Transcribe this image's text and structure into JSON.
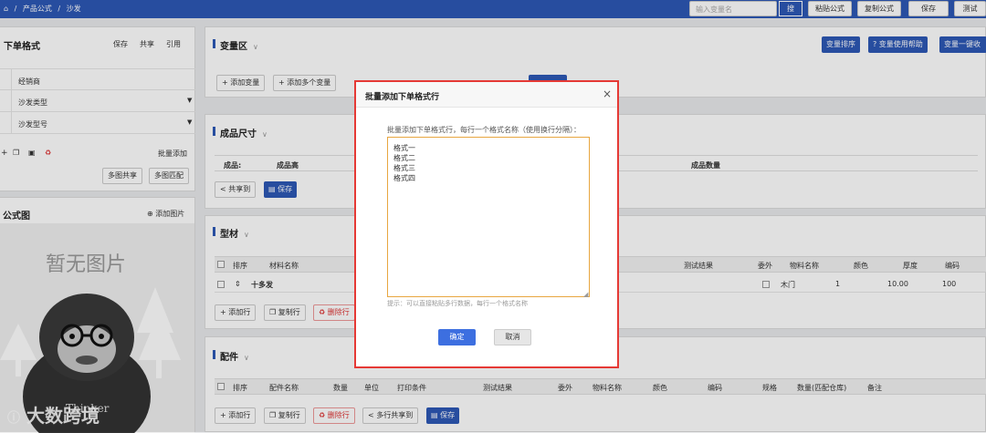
{
  "breadcrumb": {
    "sep": "/",
    "parent": "产品公式",
    "current": "沙发"
  },
  "toolbar": {
    "search_placeholder": "输入变量名",
    "search_label": "搜",
    "buttons": [
      "粘贴公式",
      "复制公式",
      "保存",
      "测试"
    ]
  },
  "left_panel": {
    "title": "下单格式",
    "actions": [
      "保存",
      "共享",
      "引用"
    ],
    "rows": [
      {
        "label": "经销商",
        "dropdown": false
      },
      {
        "label": "沙发类型",
        "dropdown": true
      },
      {
        "label": "沙发型号",
        "dropdown": true
      }
    ],
    "batch_add": "批量添加",
    "multi_share": "多图共享",
    "multi_match": "多图匹配",
    "formula_image_title": "公式图",
    "add_image": "添加图片",
    "no_image_text": "暂无图片",
    "thinker_text": "Thinker"
  },
  "variable_section": {
    "title": "变量区",
    "add_var": "添加变量",
    "add_multi_var": "添加多个变量",
    "right_buttons": [
      "变量排序",
      "? 变量使用帮助",
      "变量一键收"
    ]
  },
  "size_section": {
    "title": "成品尺寸",
    "labels": [
      "成品:",
      "成品高",
      "成品数量"
    ],
    "share_to": "共享到",
    "save": "保存"
  },
  "profile_section": {
    "title": "型材",
    "headers_left": [
      "排序",
      "材料名称"
    ],
    "headers_right": [
      "测试结果",
      "委外",
      "物料名称",
      "颜色",
      "厚度",
      "编码"
    ],
    "row": {
      "sort": "⇕",
      "name": "十多发",
      "material": "木门",
      "qty": "1",
      "thickness": "10.00",
      "code": "100"
    },
    "add_row": "添加行",
    "copy_row": "复制行",
    "delete_row": "删除行"
  },
  "parts_section": {
    "title": "配件",
    "headers": [
      "排序",
      "配件名称",
      "数量",
      "单位",
      "打印条件",
      "测试结果",
      "委外",
      "物料名称",
      "颜色",
      "编码",
      "规格",
      "数量(匹配仓库)",
      "备注"
    ],
    "add_row": "添加行",
    "copy_row": "复制行",
    "delete_row": "删除行",
    "multi_share": "多行共享到",
    "save": "保存"
  },
  "modal": {
    "title": "批量添加下单格式行",
    "close": "×",
    "description": "批量添加下单格式行，每行一个格式名称（使用换行分隔）：",
    "textarea_value": "格式一\n格式二\n格式三\n格式四",
    "hint": "提示：可以直接粘贴多行数据，每行一个格式名称",
    "confirm": "确定",
    "cancel": "取消"
  },
  "watermark": "大数跨境",
  "colors": {
    "brand": "#2d58b6",
    "danger": "#d33",
    "modal_border": "#e53935",
    "confirm": "#3d6fe0"
  }
}
